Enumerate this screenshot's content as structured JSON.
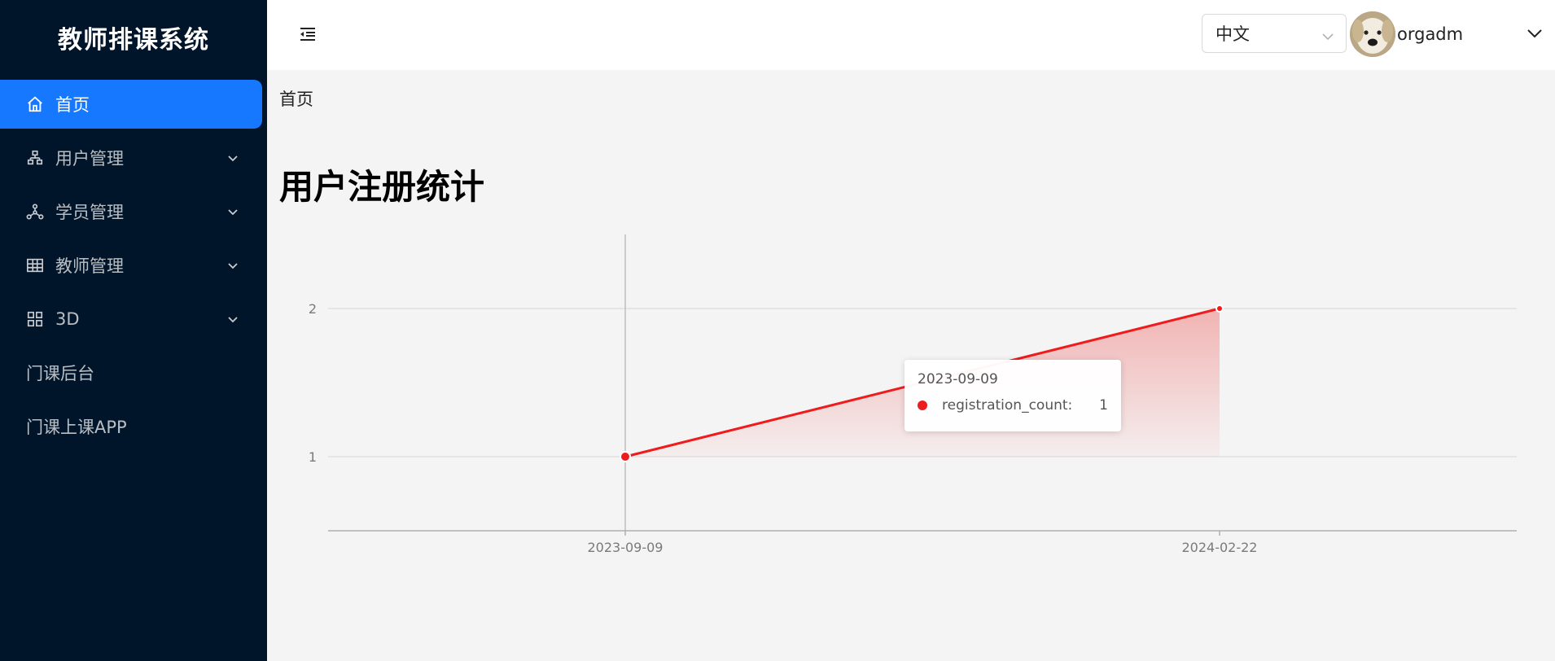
{
  "sidebar": {
    "brand": "教师排课系统",
    "items": [
      {
        "label": "首页",
        "icon": "home-icon",
        "active": true
      },
      {
        "label": "用户管理",
        "icon": "org-chart-icon",
        "expandable": true
      },
      {
        "label": "学员管理",
        "icon": "nodes-icon",
        "expandable": true
      },
      {
        "label": "教师管理",
        "icon": "table-grid-icon",
        "expandable": true
      },
      {
        "label": "3D",
        "icon": "apps-grid-icon",
        "expandable": true
      },
      {
        "label": "门课后台"
      },
      {
        "label": "门课上课APP"
      }
    ]
  },
  "header": {
    "language": "中文",
    "username": "orgadm"
  },
  "breadcrumb": "首页",
  "page_title": "用户注册统计",
  "colors": {
    "sidebar_bg": "#001529",
    "accent": "#1677ff",
    "series": "#ee1c1c"
  },
  "chart_data": {
    "type": "line",
    "x": [
      "2023-09-09",
      "2024-02-22"
    ],
    "series": [
      {
        "name": "registration_count",
        "values": [
          1,
          2
        ]
      }
    ],
    "y_ticks": [
      1,
      2
    ],
    "ylim": [
      0.5,
      2.5
    ],
    "grid": true,
    "area_fill": true,
    "tooltip": {
      "title": "2023-09-09",
      "label": "registration_count:",
      "value": 1
    }
  }
}
